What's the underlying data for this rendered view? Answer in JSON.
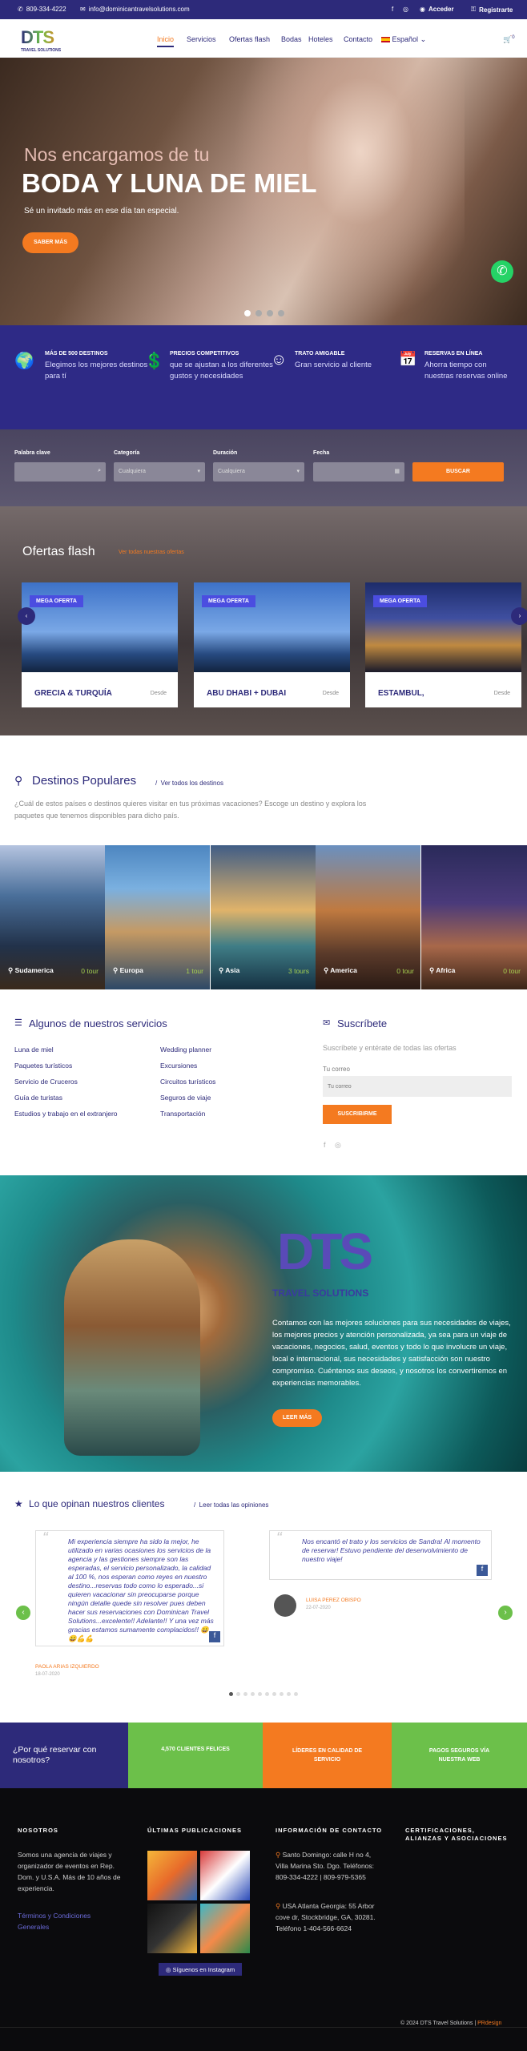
{
  "topbar": {
    "phone": "809-334-4222",
    "email": "info@dominicantravelsolutions.com",
    "login": "Acceder",
    "register": "Registrarte"
  },
  "header": {
    "logo_text": "DTS",
    "logo_sub": "TRAVEL SOLUTIONS",
    "nav": [
      "Inicio",
      "Servicios",
      "Ofertas flash",
      "Bodas",
      "Hoteles",
      "Contacto"
    ],
    "language": "Español",
    "cart_count": "0"
  },
  "hero": {
    "subtitle": "Nos encargamos de tu",
    "title": "BODA Y LUNA DE MIEL",
    "text": "Sé un invitado más en ese día tan especial.",
    "button": "SABER MÁS"
  },
  "features": [
    {
      "title": "MÁS DE 500 DESTINOS",
      "desc": "Elegimos los mejores destinos para tí"
    },
    {
      "title": "PRECIOS COMPETITIVOS",
      "desc": "que se ajustan a los diferentes gustos y necesidades"
    },
    {
      "title": "TRATO AMIGABLE",
      "desc": "Gran servicio al cliente"
    },
    {
      "title": "RESERVAS EN LÍNEA",
      "desc": "Ahorra tiempo con nuestras reservas online"
    }
  ],
  "search": {
    "keyword_label": "Palabra clave",
    "category_label": "Categoría",
    "category_value": "Cualquiera",
    "duration_label": "Duración",
    "duration_value": "Cualquiera",
    "date_label": "Fecha",
    "button": "BUSCAR"
  },
  "flash": {
    "title": "Ofertas flash",
    "link": "Ver todas nuestras ofertas",
    "cards": [
      {
        "badge": "MEGA OFERTA",
        "name": "GRECIA & TURQUÍA",
        "from": "Desde"
      },
      {
        "badge": "MEGA OFERTA",
        "name": "ABU DHABI + DUBAI",
        "from": "Desde"
      },
      {
        "badge": "MEGA OFERTA",
        "name": "ESTAMBUL,",
        "from": "Desde"
      }
    ]
  },
  "destinations": {
    "title": "Destinos Populares",
    "link": "Ver todos los destinos",
    "desc": "¿Cuál de estos países o destinos quieres visitar en tus próximas vacaciones? Escoge un destino y explora los paquetes que tenemos disponibles para dicho país.",
    "items": [
      {
        "name": "Sudamerica",
        "tours": "0 tour"
      },
      {
        "name": "Europa",
        "tours": "1 tour"
      },
      {
        "name": "Asia",
        "tours": "3 tours"
      },
      {
        "name": "America",
        "tours": "0 tour"
      },
      {
        "name": "Africa",
        "tours": "0 tour"
      }
    ]
  },
  "services": {
    "title": "Algunos de nuestros servicios",
    "col1": [
      "Luna de miel",
      "Paquetes turísticos",
      "Servicio de Cruceros",
      "Guía de turistas",
      "Estudios y trabajo en el extranjero"
    ],
    "col2": [
      "Wedding planner",
      "Excursiones",
      "Circuitos turísticos",
      "Seguros de viaje",
      "Transportación"
    ]
  },
  "subscribe": {
    "title": "Suscríbete",
    "text": "Suscríbete y entérate de todas las ofertas",
    "label": "Tu correo",
    "placeholder": "Tu correo",
    "button": "SUSCRIBIRME"
  },
  "promo": {
    "logo": "DTS",
    "logo_sub": "TRAVEL SOLUTIONS",
    "text": "Contamos con las mejores soluciones para sus necesidades de viajes, los mejores precios y atención personalizada, ya sea para un viaje de vacaciones, negocios, salud, eventos y todo lo que involucre un viaje, local e internacional, sus necesidades y satisfacción son nuestro compromiso. Cuéntenos sus deseos, y nosotros los convertiremos en experiencias memorables.",
    "button": "LEER MÁS"
  },
  "testimonials": {
    "title": "Lo que opinan nuestros clientes",
    "link": "Leer todas las opiniones",
    "items": [
      {
        "text": "Mi experiencia siempre ha sido la mejor, he utilizado en varias ocasiones los servicios de la agencia y las gestiones siempre son las esperadas, el servicio personalizado, la calidad al 100 %, nos esperan como reyes en nuestro destino...reservas todo como lo esperado...si quieren vacacionar sin preocuparse porque ningún detalle quede sin resolver pues deben hacer sus reservaciones con Dominican Travel Solutions...excelente!! Adelante!! Y una vez más gracias estamos sumamente complacidos!! 😀😀💪💪",
        "author": "PAOLA ARIAS IZQUIERDO",
        "date": "18-07-2020"
      },
      {
        "text": "Nos encantó el trato y los servicios de Sandra! Al momento de reservar! Estuvo pendiente del desenvolvimiento de nuestro viaje!",
        "author": "LUISA PEREZ OBISPO",
        "date": "22-07-2020"
      }
    ]
  },
  "why": {
    "title": "¿Por qué reservar con nosotros?",
    "items": [
      "4,570 CLIENTES FELICES",
      "LÍDERES EN CALIDAD DE SERVICIO",
      "PAGOS SEGUROS VÍA NUESTRA WEB"
    ]
  },
  "footer": {
    "about_title": "NOSOTROS",
    "about_text": "Somos una agencia de viajes y organizador de eventos en Rep. Dom. y U.S.A. Más de 10 años de experiencia.",
    "terms": "Términos y Condiciones Generales",
    "posts_title": "ÚLTIMAS PUBLICACIONES",
    "instagram": "Síguenos en Instagram",
    "contact_title": "INFORMACIÓN DE CONTACTO",
    "contact1": "Santo Domingo: calle H no 4, Villa Marina Sto. Dgo. Teléfonos: 809-334-4222 | 809-979-5365",
    "contact2": "USA Atlanta Georgia: 55 Arbor cove dr, Stockbridge, GA, 30281. Teléfono 1-404-566-6624",
    "cert_title": "CERTIFICACIONES, ALIANZAS Y ASOCIACIONES",
    "copyright": "© 2024 DTS Travel Solutions |",
    "credit": "PRdesign"
  },
  "colors": {
    "primary": "#2d2a7a",
    "accent": "#f47a20",
    "green": "#6cc04a",
    "whatsapp": "#25d366"
  }
}
